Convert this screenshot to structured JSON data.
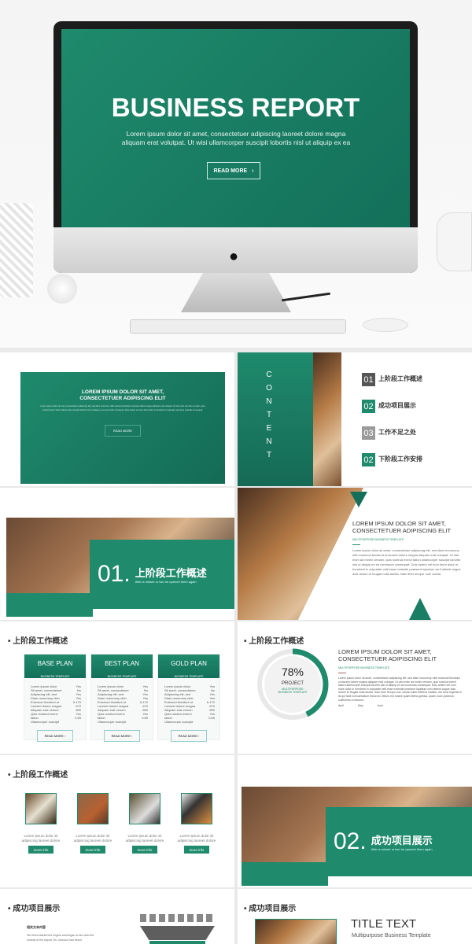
{
  "hero": {
    "title": "BUSINESS REPORT",
    "subtitle": "Lorem ipsum dolor sit amet, consectetuer adipiscing laoreet dolore magna aliquam erat volutpat. Ut wisi ullamcorper suscipit lobortis nisl ut aliquip ex ea",
    "button": "READ MORE",
    "logo": "apple-logo"
  },
  "slide1": {
    "title1": "LOREM IPSUM DOLOR SIT AMET,",
    "title2": "CONSECTETUER ADIPISCING ELIT",
    "body": "Lorem ipsum dolor sit amet, consectetuer adipiscing elit, sed diam nonummy nibh euismod tincidunt ut laoreet dolore magna aliquam erat volutpat. Ut wisi enim ad minim veniam, quis nostrud exerci tation ullamcorper suscipit lobortis nisl ut aliquip ex ea commodo consequat. Duis autem vel eum iriure dolor in hendrerit in vulputate velit esse molestie consequat.",
    "button": "READ MORE"
  },
  "contents": {
    "vertical": "CONTENT",
    "items": [
      {
        "num": "01",
        "label": "上阶段工作概述",
        "color": "#555555"
      },
      {
        "num": "02",
        "label": "成功项目展示",
        "color": "#1f8a6c"
      },
      {
        "num": "03",
        "label": "工作不足之处",
        "color": "#9a9a9a"
      },
      {
        "num": "02",
        "label": "下阶段工作安排",
        "color": "#1f8a6c"
      }
    ]
  },
  "section1": {
    "num": "01.",
    "title": "上阶段工作概述",
    "sub": "After a minute or two he opened them again"
  },
  "slide4": {
    "title1": "LOREM IPSUM DOLOR SIT AMET,",
    "title2": "CONSECTETUER ADIPISCING ELIT",
    "tag": "MULTIPURPOSE BUSINESS TEMPLATE",
    "body": "Lorem ipsum dolor sit amet, consectetuer adipiscing elit, sed diam nonummy nibh euismod tincidunt ut laoreet dolore magna aliquam erat volutpat. Ut wisi enim ad minim veniam, quis nostrud exerci tation ullamcorper suscipit lobortis nisl ut aliquip ex ea commodo consequat. Duis autem vel eum iriure dolor in hendrerit in vulputate velit esse molestie praesent luptatum zzril delenit augue duis dolore te feugait nulla facilisi. Nam liber tempor cum soluta"
  },
  "plans": {
    "heading": "上阶段工作概述",
    "labels": "Lorem ipsum dolor\nSit amet, consectetuer\nAdipiscing elit, sed\nDiam nonummy nibh\nEuismod tincidunt ut\nLaoreet dolore magna\nAliquam erat venom\nQuis nostrud exerci\ntation\nUllamcorper suscipit",
    "values": "Yes\nNo\nYes\nYes\n6.170\n670\n890\nYes\n0.89",
    "button": "READ MORE",
    "items": [
      {
        "name": "BASE PLAN",
        "sub": "BUSINESS TEMPLATE"
      },
      {
        "name": "BEST PLAN",
        "sub": "BUSINESS TEMPLATE"
      },
      {
        "name": "GOLD PLAN",
        "sub": "BUSINESS TEMPLATE"
      }
    ]
  },
  "progress": {
    "heading": "上阶段工作概述",
    "percent": 78,
    "percent_label": "78%",
    "label": "PROJECT",
    "sub": "MULTIPURPOSE BUSINESS TEMPLATE",
    "title1": "LOREM IPSUM DOLOR SIT AMET,",
    "title2": "CONSECTETUER ADIPISCING ELIT",
    "tag": "MULTIPURPOSE BUSINESS TEMPLATE",
    "body": "Lorem ipsum dolor sit amet, consectetuer adipiscing elit, sed diam nonummy nibh euismod tincidunt ut laoreet dolore magna aliquam erat volutpat. Ut wisi enim ad minim veniam, quis nostrud exerci tation ullamcorper suscipit lobortis nisl ut aliquip ex ea commodo consequat. Duis autem vel eum iriure dolor in hendrerit in vulputate velit esse molestie praesent luptatum zzril delenit augue duis dolore te feugait nulla facilisi. Nam liber tempor cum soluta nobis eleifend insitam; est usus legentis in iis qui facit consuetudium lectorum. Mirum est notare quam littera gothica, quam nunc putamus sollemnes in futurum.",
    "legend": [
      "April",
      "May",
      "June"
    ],
    "colors": {
      "accent": "#1f8a6c",
      "track": "#e8e8e8"
    }
  },
  "gallery": {
    "heading": "上阶段工作概述",
    "button": "more info",
    "items": [
      {
        "text": "Lorem ipsum dolor sit adipiscing laoreet dolore"
      },
      {
        "text": "Lorem ipsum dolor sit adipiscing laoreet dolore"
      },
      {
        "text": "Lorem ipsum dolor sit adipiscing laoreet dolore"
      },
      {
        "text": "Lorem ipsum dolor sit adipiscing laoreet dolore"
      }
    ]
  },
  "section2": {
    "num": "02.",
    "title": "成功项目展示",
    "sub": "After a minute or two he opened them again"
  },
  "funnel": {
    "heading": "成功项目展示",
    "text_title": "相关文本内容",
    "text": "His friend started the engine and began to taxi onto the runway of the airport. Mr. Johnson had heard"
  },
  "last": {
    "heading": "成功项目展示",
    "title": "TITLE TEXT",
    "sub": "Multipurpose Business Template"
  }
}
